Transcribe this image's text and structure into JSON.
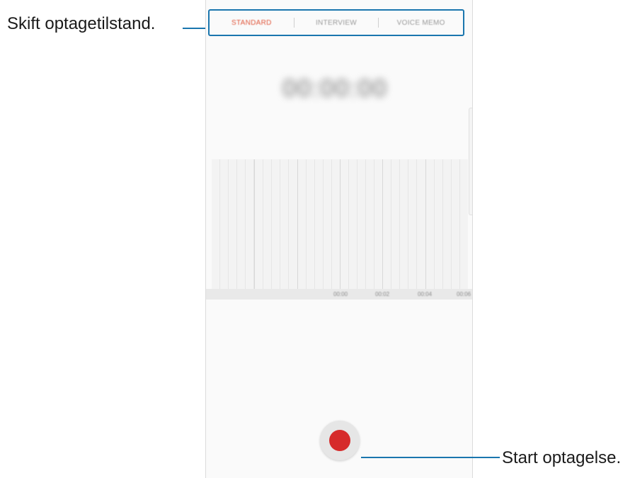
{
  "callouts": {
    "mode_switch": "Skift optagetilstand.",
    "start_recording": "Start optagelse."
  },
  "mode_tabs": {
    "items": [
      "STANDARD",
      "INTERVIEW",
      "VOICE MEMO"
    ],
    "active": "STANDARD"
  },
  "timer": "00:00:00",
  "time_ruler": {
    "ticks": [
      "00:00",
      "00:02",
      "00:04",
      "00:06"
    ]
  },
  "colors": {
    "callout_line": "#1a76ae",
    "active_tab": "#e0573c",
    "record_dot": "#d62b2b"
  },
  "icons": {
    "record": "record-icon"
  }
}
